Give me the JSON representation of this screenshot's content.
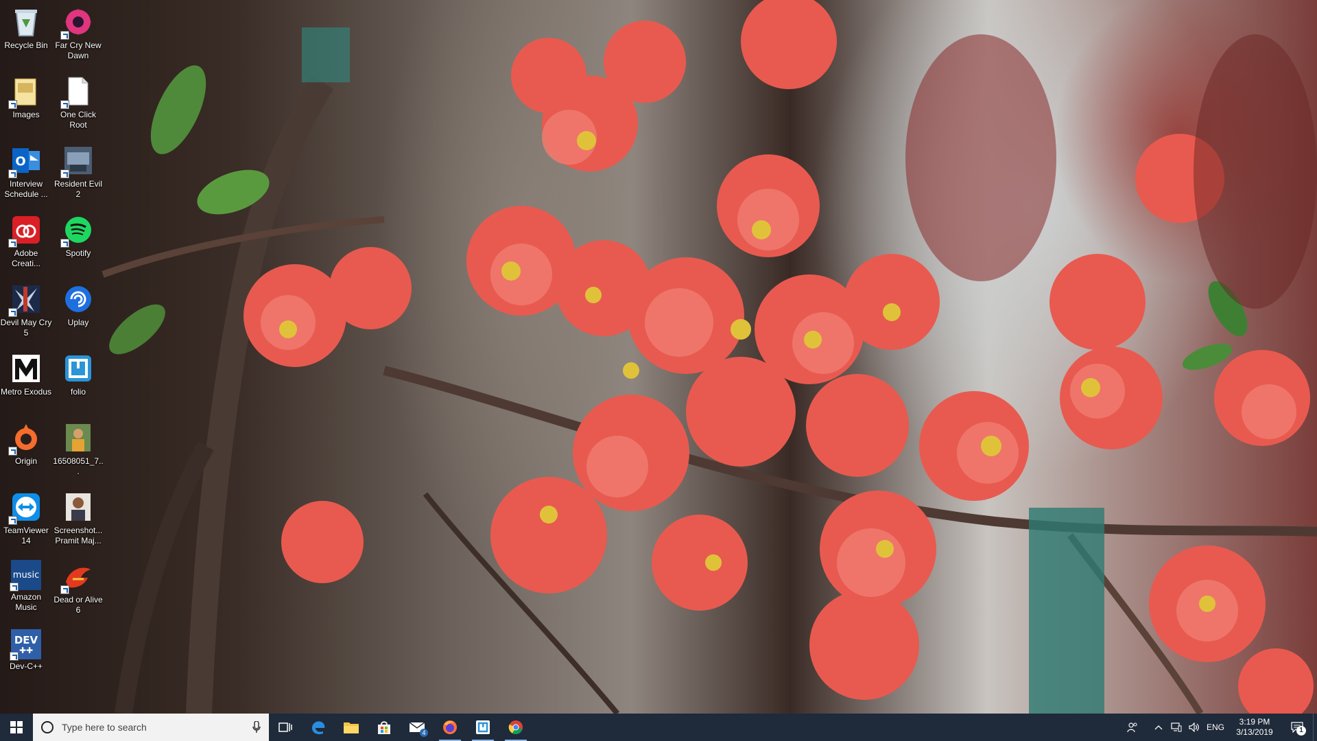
{
  "desktop": {
    "icons": [
      {
        "label": "Recycle Bin",
        "icon": "recycle-bin-icon"
      },
      {
        "label": "Far Cry New Dawn",
        "icon": "far-cry-icon"
      },
      {
        "label": "Images",
        "icon": "folder-icon"
      },
      {
        "label": "One Click Root",
        "icon": "blank-file-icon"
      },
      {
        "label": "Interview Schedule ...",
        "icon": "outlook-icon"
      },
      {
        "label": "Resident Evil 2",
        "icon": "resident-evil-icon"
      },
      {
        "label": "Adobe Creati...",
        "icon": "adobe-cc-icon"
      },
      {
        "label": "Spotify",
        "icon": "spotify-icon"
      },
      {
        "label": "Devil May Cry 5",
        "icon": "devil-may-cry-icon"
      },
      {
        "label": "Uplay",
        "icon": "uplay-icon"
      },
      {
        "label": "Metro Exodus",
        "icon": "metro-exodus-icon"
      },
      {
        "label": "folio",
        "icon": "folio-icon"
      },
      {
        "label": "Origin",
        "icon": "origin-icon"
      },
      {
        "label": "16508051_7...",
        "icon": "photo-thumbnail-icon"
      },
      {
        "label": "TeamViewer 14",
        "icon": "teamviewer-icon"
      },
      {
        "label": "Screenshot... Pramit Maj...",
        "icon": "photo-thumbnail-icon"
      },
      {
        "label": "Amazon Music",
        "icon": "amazon-music-icon"
      },
      {
        "label": "Dead or Alive 6",
        "icon": "dead-or-alive-icon"
      },
      {
        "label": "Dev-C++",
        "icon": "dev-cpp-icon"
      }
    ],
    "icon_text": {
      "amazon_music": "music",
      "dev": "DEV"
    }
  },
  "taskbar": {
    "search_placeholder": "Type here to search",
    "pinned": [
      {
        "name": "task-view",
        "icon": "task-view-icon"
      },
      {
        "name": "edge",
        "icon": "edge-icon"
      },
      {
        "name": "file-explorer",
        "icon": "folder-icon"
      },
      {
        "name": "store",
        "icon": "store-icon"
      },
      {
        "name": "mail",
        "icon": "mail-icon",
        "badge": "4"
      },
      {
        "name": "firefox",
        "icon": "firefox-icon"
      },
      {
        "name": "folio",
        "icon": "folio-icon"
      },
      {
        "name": "chrome",
        "icon": "chrome-icon"
      }
    ],
    "tray": {
      "language": "ENG",
      "time": "3:19 PM",
      "date": "3/13/2019",
      "notification_count": "1"
    }
  },
  "colors": {
    "taskbar_bg": "#1f2a3a",
    "accent": "#0078d7"
  }
}
